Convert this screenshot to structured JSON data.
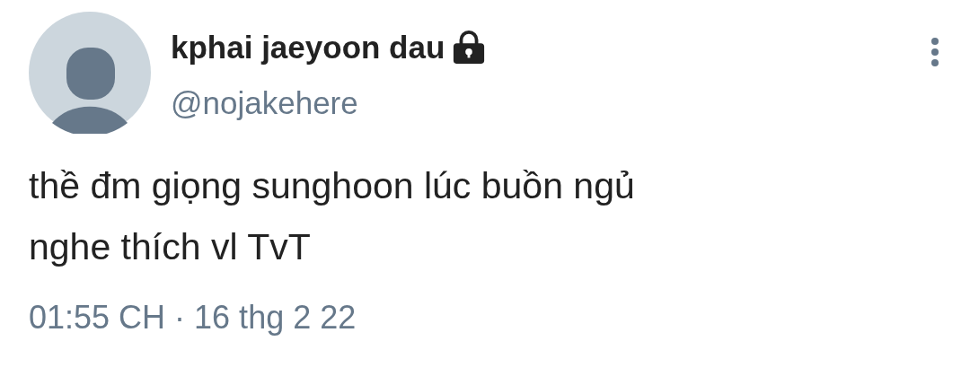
{
  "author": {
    "name": "kphai jaeyoon dau",
    "protected": true,
    "handle": "@nojakehere"
  },
  "tweet": {
    "text_lines": [
      "thề đm giọng sunghoon lúc buồn ngủ",
      "nghe thích vl TvT"
    ]
  },
  "timestamp": "01:55 CH · 16 thg 2 22"
}
